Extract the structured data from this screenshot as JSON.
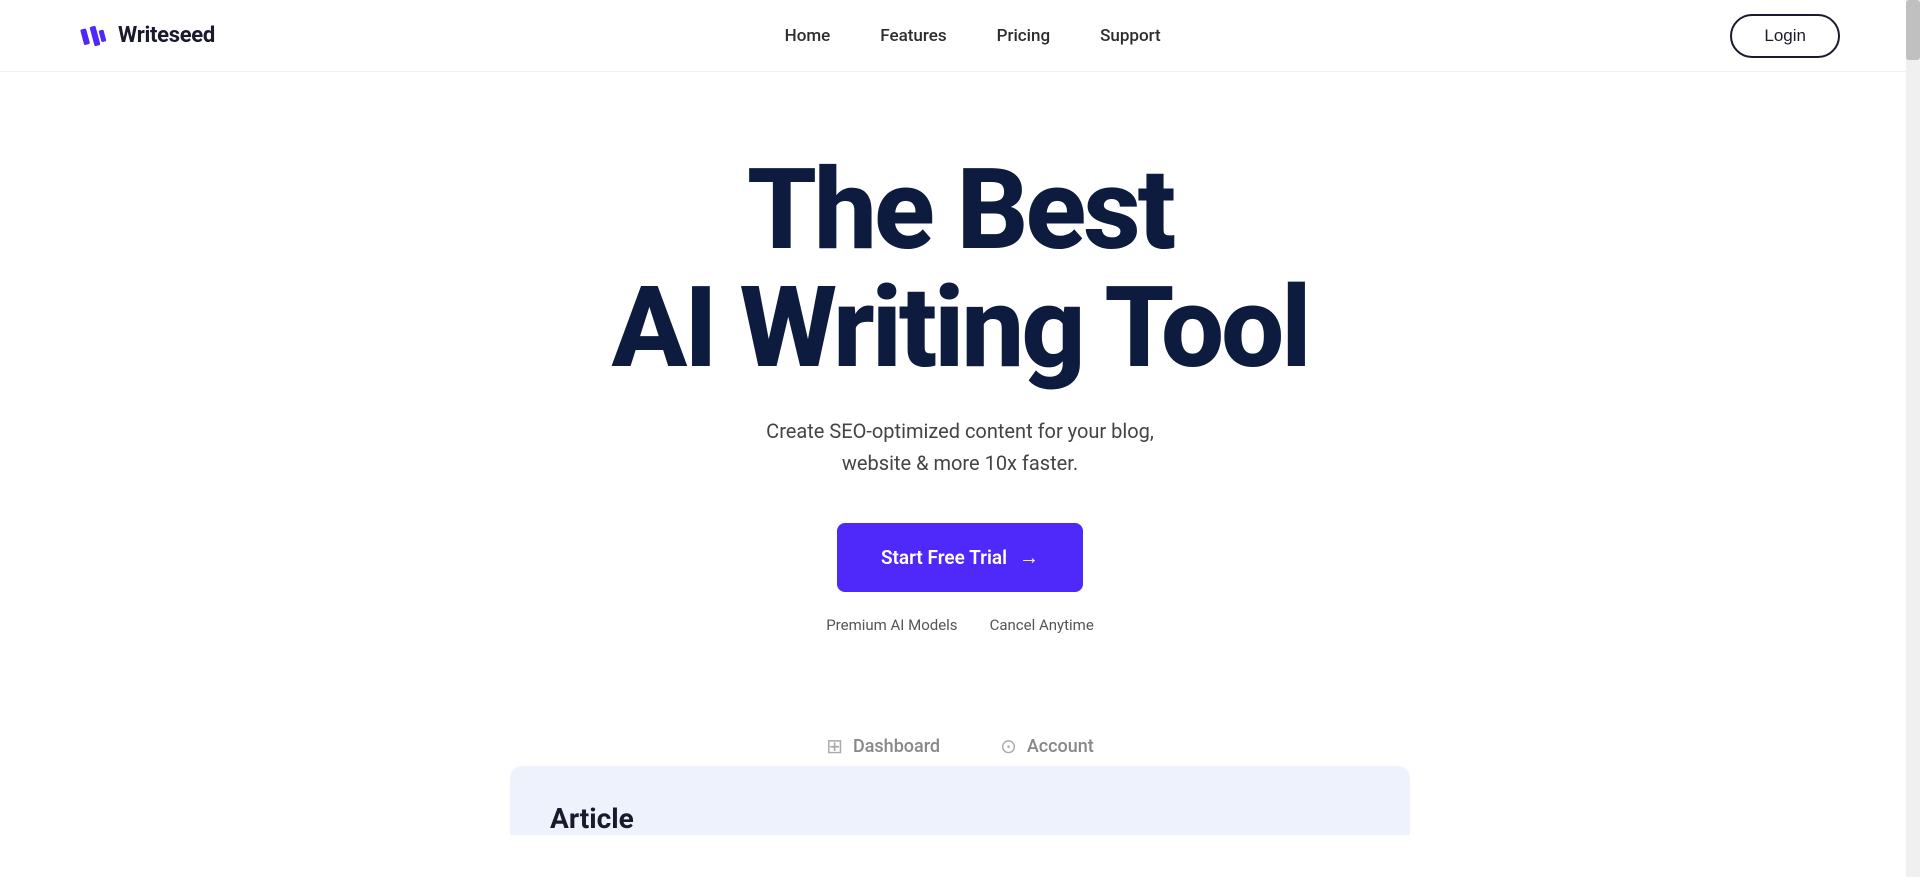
{
  "brand": {
    "logo_text": "Writeseed",
    "logo_icon": "✦"
  },
  "navbar": {
    "links": [
      {
        "label": "Home",
        "id": "home"
      },
      {
        "label": "Features",
        "id": "features"
      },
      {
        "label": "Pricing",
        "id": "pricing"
      },
      {
        "label": "Support",
        "id": "support"
      }
    ],
    "login_label": "Login"
  },
  "hero": {
    "title_line1": "The Best",
    "title_line2": "AI Writing Tool",
    "subtitle": "Create SEO-optimized content for your blog, website & more 10x faster.",
    "cta_label": "Start Free Trial",
    "cta_arrow": "→",
    "badge1": "Premium AI Models",
    "badge2": "Cancel Anytime"
  },
  "bottom": {
    "tab1_label": "Dashboard",
    "tab2_label": "Account",
    "article_heading": "Article"
  }
}
